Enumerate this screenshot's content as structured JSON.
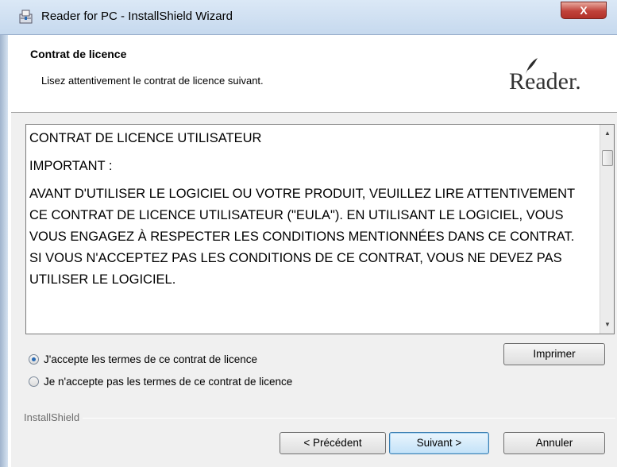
{
  "window": {
    "title": "Reader for PC - InstallShield Wizard",
    "close_label": "X"
  },
  "header": {
    "title": "Contrat de licence",
    "subtitle": "Lisez attentivement le contrat de licence suivant.",
    "logo_text": "Reader."
  },
  "eula": {
    "paragraphs": [
      "CONTRAT DE LICENCE UTILISATEUR",
      "IMPORTANT :",
      "AVANT D'UTILISER LE LOGICIEL OU VOTRE PRODUIT, VEUILLEZ LIRE ATTENTIVEMENT CE CONTRAT DE LICENCE UTILISATEUR (\"EULA\"). EN UTILISANT LE LOGICIEL, VOUS VOUS ENGAGEZ À RESPECTER LES CONDITIONS MENTIONNÉES DANS CE CONTRAT. SI VOUS N'ACCEPTEZ PAS LES CONDITIONS DE CE CONTRAT, VOUS NE DEVEZ PAS UTILISER LE LOGICIEL."
    ]
  },
  "options": {
    "accept_label": "J'accepte les termes de ce contrat de licence",
    "decline_label": "Je n'accepte pas les termes de ce contrat de licence",
    "selected": "accept"
  },
  "buttons": {
    "print_label": "Imprimer",
    "back_label": "< Précédent",
    "next_label": "Suivant >",
    "cancel_label": "Annuler"
  },
  "footer": {
    "brand_label": "InstallShield"
  }
}
